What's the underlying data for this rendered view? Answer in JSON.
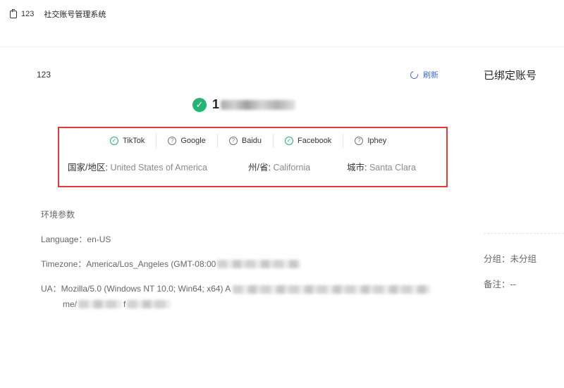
{
  "topbar": {
    "tab_id": "123",
    "app_title": "社交账号管理系统"
  },
  "profile": {
    "name": "123",
    "refresh_label": "刷新",
    "ip_prefix": "1"
  },
  "platforms": [
    {
      "name": "TikTok",
      "status": "ok"
    },
    {
      "name": "Google",
      "status": "unknown"
    },
    {
      "name": "Baidu",
      "status": "unknown"
    },
    {
      "name": "Facebook",
      "status": "ok"
    },
    {
      "name": "Iphey",
      "status": "unknown"
    }
  ],
  "location": {
    "country_label": "国家/地区:",
    "country": "United States of America",
    "state_label": "州/省:",
    "state": "California",
    "city_label": "城市:",
    "city": "Santa Clara"
  },
  "env": {
    "title": "环境参数",
    "language_label": "Language：",
    "language": "en-US",
    "timezone_label": "Timezone：",
    "timezone": "America/Los_Angeles (GMT-08:00",
    "ua_label": "UA：",
    "ua": "Mozilla/5.0 (Windows NT 10.0; Win64; x64) A",
    "ua_cont_a": "me/",
    "ua_cont_b": "f"
  },
  "side": {
    "title": "已绑定账号",
    "group_label": "分组：",
    "group_value": "未分组",
    "note_label": "备注：",
    "note_value": "--"
  },
  "colors": {
    "ok": "#22b573",
    "link": "#3d6bd6",
    "highlight": "#e53935"
  }
}
